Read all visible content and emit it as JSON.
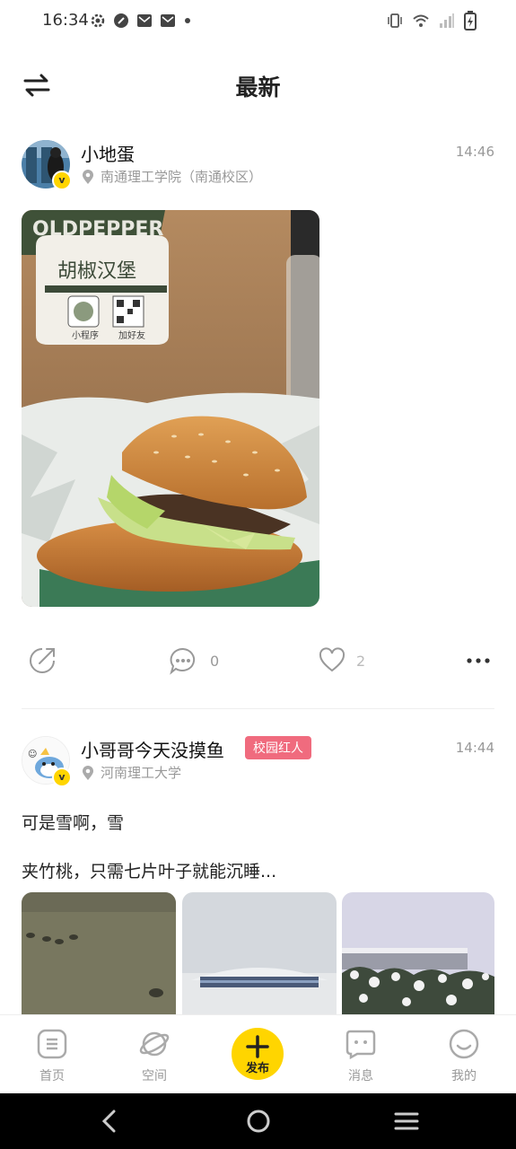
{
  "status_bar": {
    "time": "16:34"
  },
  "header": {
    "title": "最新",
    "switch_icon": "swap-arrows-icon"
  },
  "posts": [
    {
      "username": "小地蛋",
      "time": "14:46",
      "location": "南通理工学院（南通校区）",
      "verified": "v",
      "image": {
        "package_brand": "OLDPEPPER",
        "package_title": "胡椒汉堡",
        "qr_left": "小程序",
        "qr_right": "加好友"
      },
      "actions": {
        "comments": "0",
        "likes": "2"
      }
    },
    {
      "username": "小哥哥今天没摸鱼",
      "badge": "校园红人",
      "time": "14:44",
      "location": "河南理工大学",
      "verified": "v",
      "text_line1": "可是雪啊，雪",
      "text_line2": "夹竹桃，只需七片叶子就能沉睡..."
    }
  ],
  "tabbar": {
    "home": "首页",
    "space": "空间",
    "publish": "发布",
    "messages": "消息",
    "mine": "我的"
  },
  "colors": {
    "accent": "#ffd500",
    "badge": "#f06b7e",
    "muted": "#999999"
  }
}
